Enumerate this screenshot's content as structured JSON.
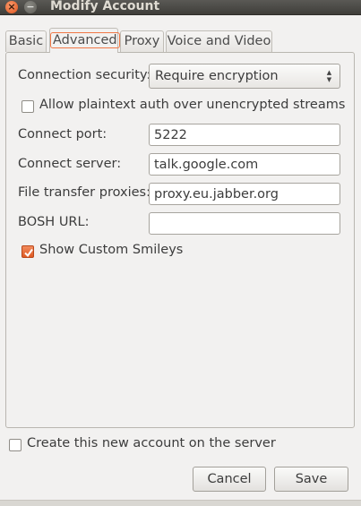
{
  "window": {
    "title": "Modify Account",
    "close_glyph": "×",
    "minimize_glyph": "−"
  },
  "tabs": [
    {
      "label": "Basic"
    },
    {
      "label": "Advanced",
      "active": true
    },
    {
      "label": "Proxy"
    },
    {
      "label": "Voice and Video"
    }
  ],
  "advanced": {
    "connection_security": {
      "label": "Connection security:",
      "value": "Require encryption"
    },
    "allow_plaintext": {
      "label": "Allow plaintext auth over unencrypted streams",
      "checked": false
    },
    "connect_port": {
      "label": "Connect port:",
      "value": "5222"
    },
    "connect_server": {
      "label": "Connect server:",
      "value": "talk.google.com"
    },
    "file_transfer_proxies": {
      "label": "File transfer proxies:",
      "value": "proxy.eu.jabber.org"
    },
    "bosh_url": {
      "label": "BOSH URL:",
      "value": ""
    },
    "show_custom_smileys": {
      "label": "Show Custom Smileys",
      "checked": true
    }
  },
  "create_account": {
    "label": "Create this new account on the server",
    "checked": false
  },
  "buttons": {
    "cancel": "Cancel",
    "save": "Save"
  },
  "colors": {
    "accent": "#f07746",
    "titlebar": "#3f3e3a",
    "background": "#f2f1f0"
  }
}
